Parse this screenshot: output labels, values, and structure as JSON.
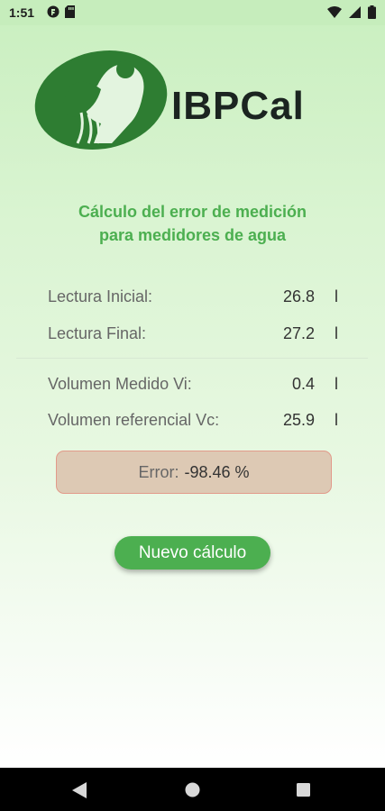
{
  "status_bar": {
    "time": "1:51",
    "left_icons": [
      "app-notification-icon",
      "sd-card-icon"
    ],
    "right_icons": [
      "wifi-icon",
      "cell-signal-icon",
      "battery-icon"
    ]
  },
  "logo": {
    "brand_text": "IBPCal",
    "brand_color": "#1b2420",
    "emblem_color": "#2e7d32"
  },
  "heading": {
    "line1": "Cálculo del error de medición",
    "line2": "para medidores de agua"
  },
  "readings": [
    {
      "label": "Lectura Inicial:",
      "value": "26.8",
      "unit": "l"
    },
    {
      "label": "Lectura Final:",
      "value": "27.2",
      "unit": "l"
    },
    {
      "label": "Volumen Medido Vi:",
      "value": "0.4",
      "unit": "l"
    },
    {
      "label": "Volumen referencial Vc:",
      "value": "25.9",
      "unit": "l"
    }
  ],
  "error": {
    "label": "Error:",
    "value": "-98.46 %"
  },
  "new_calc_button": {
    "label": "Nuevo cálculo"
  },
  "colors": {
    "accent": "#4caf50",
    "error_bg": "#ddc9b4",
    "error_border": "#e29a8a"
  },
  "nav_bar": {
    "icons": [
      "back-icon",
      "home-icon",
      "recents-icon"
    ]
  }
}
